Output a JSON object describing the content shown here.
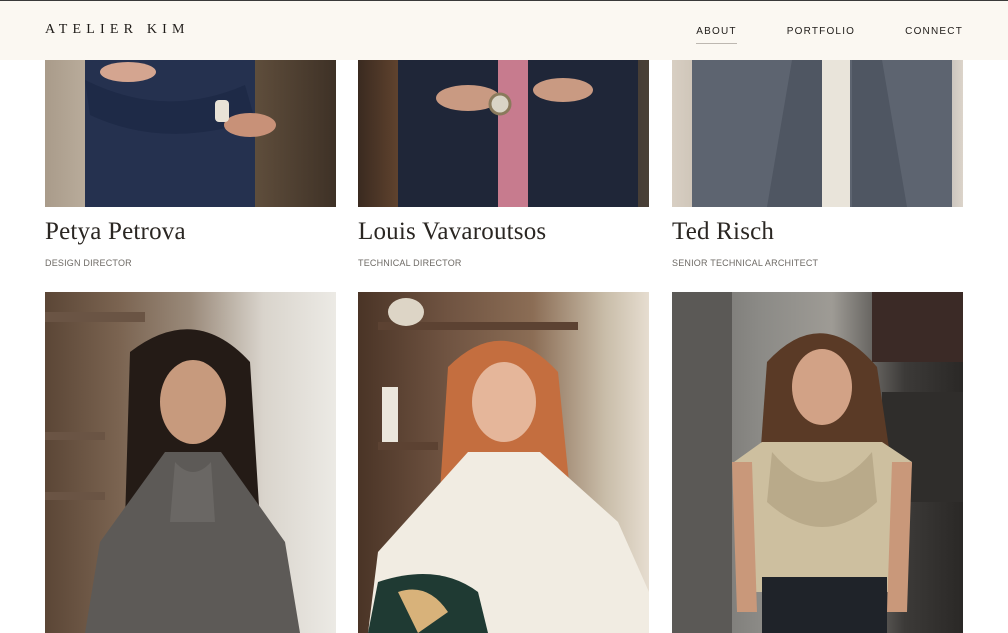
{
  "header": {
    "logo": "ATELIER KIM",
    "nav": [
      {
        "label": "ABOUT",
        "active": true
      },
      {
        "label": "PORTFOLIO",
        "active": false
      },
      {
        "label": "CONNECT",
        "active": false
      }
    ]
  },
  "team": [
    {
      "name": "Petya Petrova",
      "role": "DESIGN DIRECTOR"
    },
    {
      "name": "Louis Vavaroutsos",
      "role": "TECHNICAL DIRECTOR"
    },
    {
      "name": "Ted Risch",
      "role": "SENIOR TECHNICAL ARCHITECT"
    }
  ],
  "colors": {
    "header_bg": "#fbf8f2",
    "text": "#2a2622",
    "role_text": "#6e6a65"
  }
}
